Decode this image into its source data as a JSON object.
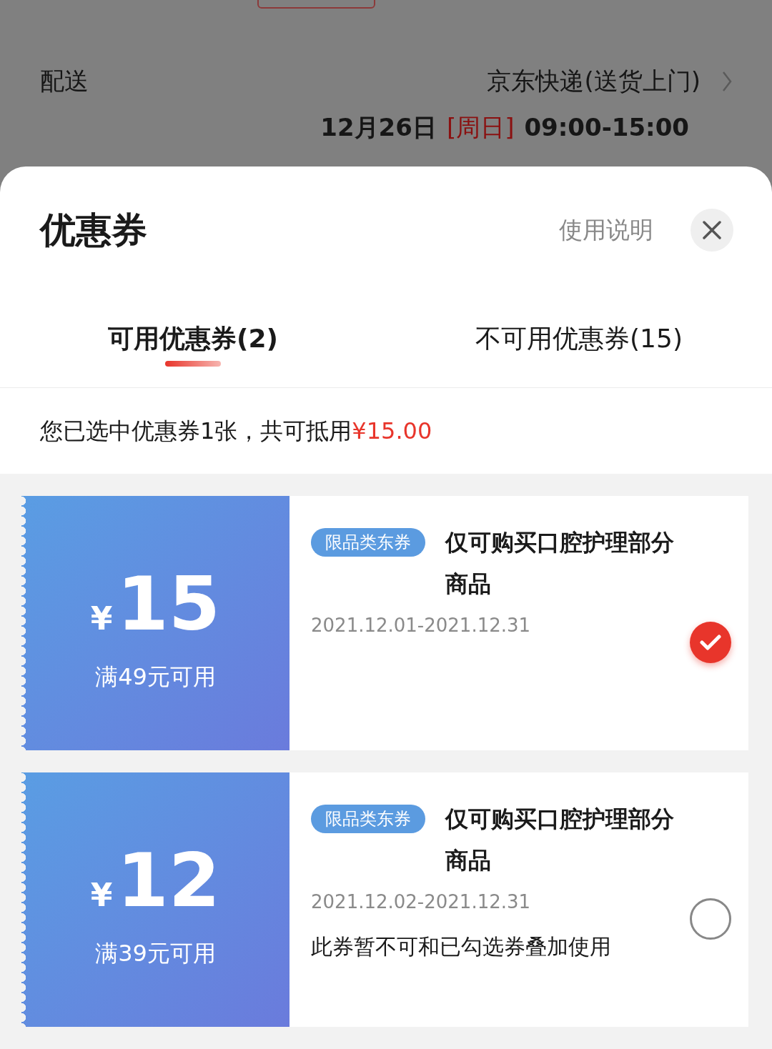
{
  "background": {
    "delivery": {
      "label": "配送",
      "method": "京东快递(送货上门)",
      "date": "12月26日",
      "weekday": "[周日]",
      "time": "09:00-15:00"
    }
  },
  "sheet": {
    "title": "优惠券",
    "help_link": "使用说明",
    "tabs": [
      {
        "label": "可用优惠券(2)",
        "selected": true
      },
      {
        "label": "不可用优惠券(15)",
        "selected": false
      }
    ],
    "summary": {
      "text": "您已选中优惠券1张，共可抵用",
      "amount": "¥15.00"
    },
    "coupons": [
      {
        "currency": "¥",
        "amount": "15",
        "condition": "满49元可用",
        "tag": "限品类东券",
        "title": "仅可购买口腔护理部分商品",
        "validity": "2021.12.01-2021.12.31",
        "selected": true
      },
      {
        "currency": "¥",
        "amount": "12",
        "condition": "满39元可用",
        "tag": "限品类东券",
        "title": "仅可购买口腔护理部分商品",
        "validity": "2021.12.02-2021.12.31",
        "note": "此券暂不可和已勾选券叠加使用",
        "selected": false
      }
    ]
  }
}
